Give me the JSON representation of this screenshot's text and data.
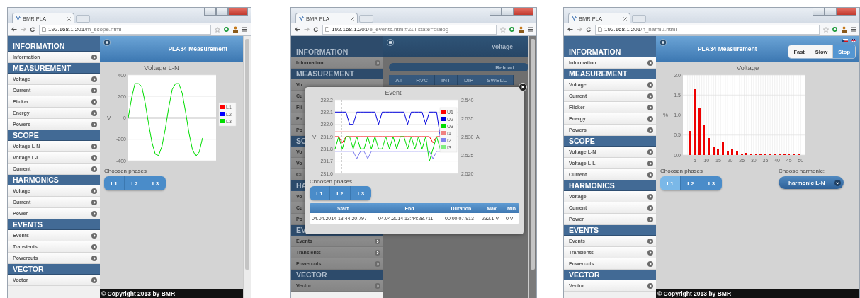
{
  "windows": [
    {
      "browser_tab": {
        "title": "BMR PLA"
      },
      "url": {
        "host": "192.168.1.201",
        "path": "/m_scope.html"
      },
      "dimmed": false,
      "sidebar": {
        "sections": [
          {
            "title": "INFORMATION",
            "items": [
              {
                "label": "Information"
              }
            ]
          },
          {
            "title": "MEASUREMENT",
            "items": [
              {
                "label": "Voltage"
              },
              {
                "label": "Current"
              },
              {
                "label": "Flicker"
              },
              {
                "label": "Energy"
              },
              {
                "label": "Powers"
              }
            ]
          },
          {
            "title": "SCOPE",
            "items": [
              {
                "label": "Voltage L-N"
              },
              {
                "label": "Voltage L-L"
              },
              {
                "label": "Current"
              }
            ]
          },
          {
            "title": "HARMONICS",
            "items": [
              {
                "label": "Voltage"
              },
              {
                "label": "Current"
              },
              {
                "label": "Power"
              }
            ]
          },
          {
            "title": "EVENTS",
            "items": [
              {
                "label": "Events"
              },
              {
                "label": "Transients"
              },
              {
                "label": "Powercuts"
              }
            ]
          },
          {
            "title": "VECTOR",
            "items": [
              {
                "label": "Vector"
              }
            ]
          }
        ]
      },
      "header": {
        "title": "PLA34 Measurement"
      },
      "content": {
        "kind": "scope",
        "chart_data": {
          "type": "line",
          "title": "Voltage L-N",
          "ylabel": "V",
          "grid": true,
          "legend": "right",
          "categories": [
            null,
            null,
            null,
            null,
            null,
            null,
            null,
            null,
            null,
            null,
            null,
            null,
            null,
            null,
            null,
            null,
            null,
            null,
            null,
            null,
            null,
            null,
            null,
            null,
            null,
            null,
            null
          ],
          "ylim": [
            -400,
            400
          ],
          "yticks": [
            -400,
            -200,
            0,
            200,
            400
          ],
          "series": [
            {
              "name": "L1",
              "color": "#ff0000",
              "values": [
                null,
                null,
                null,
                null,
                null,
                null,
                null,
                null,
                null,
                null,
                null,
                null,
                null,
                null,
                null,
                null,
                null,
                null,
                null,
                null,
                null,
                null,
                null,
                null,
                null,
                null,
                null
              ]
            },
            {
              "name": "L2",
              "color": "#0000ff",
              "values": [
                null,
                null,
                null,
                null,
                null,
                null,
                null,
                null,
                null,
                null,
                null,
                null,
                null,
                null,
                null,
                null,
                null,
                null,
                null,
                null,
                null,
                null,
                null,
                null,
                null,
                null,
                null
              ]
            },
            {
              "name": "L3",
              "color": "#00dd00",
              "values": [
                0,
                187,
                320,
                320,
                294,
                144,
                -49,
                -227,
                -339,
                -352,
                -263,
                -97,
                97,
                263,
                320,
                320,
                228,
                50,
                -143,
                -294,
                -359,
                -320,
                -188,
                null,
                null,
                null,
                null
              ]
            }
          ]
        },
        "phases_label": "Choosen phases",
        "phases": [
          {
            "label": "L1",
            "selected": false
          },
          {
            "label": "L2",
            "selected": false
          },
          {
            "label": "L3",
            "selected": false
          }
        ]
      },
      "footer": "© Copyright 2013 by BMR"
    },
    {
      "browser_tab": {
        "title": "BMR PLA"
      },
      "url": {
        "host": "192.168.1.201",
        "path": "/e_events.html#&ui-state=dialog"
      },
      "dimmed": true,
      "sidebar": {
        "sections": [
          {
            "title": "INFORMATION",
            "items": [
              {
                "label": "Information"
              }
            ]
          },
          {
            "title": "MEASUREMENT",
            "items": [
              {
                "label": "Vo"
              },
              {
                "label": "Cu"
              },
              {
                "label": "Fli"
              },
              {
                "label": "En"
              },
              {
                "label": "Po"
              }
            ]
          },
          {
            "title": "SC",
            "items": [
              {
                "label": "Vo"
              },
              {
                "label": "Vo"
              },
              {
                "label": "Cu"
              }
            ]
          },
          {
            "title": "HA",
            "items": [
              {
                "label": "Vo"
              },
              {
                "label": "Cu"
              },
              {
                "label": "Po"
              }
            ]
          },
          {
            "title": "EV",
            "items": [
              {
                "label": "Events"
              },
              {
                "label": "Transients"
              },
              {
                "label": "Powercuts"
              }
            ]
          },
          {
            "title": "VECTOR",
            "items": [
              {
                "label": "Vector"
              }
            ]
          }
        ]
      },
      "header": {
        "title": "Voltage"
      },
      "content": {
        "kind": "events",
        "reload": "Reload",
        "tabs": [
          {
            "label": "All",
            "selected": false
          },
          {
            "label": "RVC",
            "selected": false
          },
          {
            "label": "INT",
            "selected": false
          },
          {
            "label": "DIP",
            "selected": false
          },
          {
            "label": "SWELL",
            "selected": false
          }
        ]
      },
      "dialog": {
        "chart_data": {
          "type": "line",
          "title": "Event",
          "ylabel": "V",
          "grid": true,
          "legend": "inside right",
          "categories": [
            null,
            null,
            null,
            null,
            null,
            null,
            null,
            null,
            null,
            null,
            null,
            null,
            null,
            null,
            null,
            null,
            null,
            null,
            null,
            null,
            null,
            null,
            null,
            null,
            null,
            null,
            null,
            null,
            null,
            null,
            null,
            null,
            null,
            null,
            null
          ],
          "ylim": [
            231.6,
            232.2
          ],
          "yticks": [
            {
              "value": 231.6,
              "label": "231.6"
            },
            {
              "value": 231.7,
              "label": "231.7"
            },
            {
              "value": 231.8,
              "label": "231.8"
            },
            {
              "value": 231.9,
              "label": "231.9"
            },
            {
              "value": 232.0,
              "label": "232.0"
            },
            {
              "value": 232.1,
              "label": "232.1"
            },
            {
              "value": 232.2,
              "label": "232.2"
            }
          ],
          "series": [
            {
              "name": "U1",
              "color": "#ff0000",
              "values": [
                231.9,
                231.9,
                231.85,
                231.9,
                231.9,
                231.9,
                231.9,
                231.9,
                231.9,
                231.9,
                231.9,
                231.9,
                231.9,
                231.9,
                231.9,
                231.9,
                231.9,
                231.9,
                231.9,
                231.9,
                231.9,
                231.9,
                231.9,
                231.9,
                231.9,
                231.9,
                231.9,
                231.85,
                231.9,
                231.9,
                null,
                null,
                null,
                null,
                null
              ]
            },
            {
              "name": "U2",
              "color": "#0000dd",
              "values": [
                232.1,
                232.1,
                232.1,
                232.1,
                232.0,
                232.0,
                232.1,
                232.1,
                232.1,
                232.1,
                232.1,
                232.1,
                232.0,
                232.1,
                232.1,
                232.1,
                232.1,
                232.1,
                232.1,
                232.1,
                232.0,
                232.1,
                232.1,
                232.1,
                232.1,
                232.0,
                232.1,
                232.1,
                232.1,
                231.9,
                null,
                null,
                null,
                null,
                null
              ]
            },
            {
              "name": "U3",
              "color": "#00dd00",
              "values": [
                231.8,
                231.9,
                231.8,
                231.9,
                231.9,
                231.8,
                231.9,
                231.8,
                231.8,
                231.9,
                231.8,
                231.9,
                231.8,
                231.8,
                231.9,
                231.8,
                231.9,
                231.8,
                231.9,
                231.9,
                231.8,
                231.9,
                231.8,
                231.9,
                231.8,
                231.9,
                231.7,
                231.8,
                231.9,
                231.8,
                null,
                null,
                null,
                null,
                null
              ]
            },
            {
              "name": "I1",
              "color": "#f08080",
              "values": [
                231.94,
                231.94,
                231.94,
                231.94,
                231.94,
                231.94,
                231.94,
                231.94,
                231.94,
                231.94,
                231.94,
                231.94,
                231.94,
                231.94,
                231.94,
                231.94,
                231.94,
                231.94,
                231.94,
                231.94,
                231.94,
                231.94,
                231.94,
                231.94,
                231.94,
                231.94,
                231.94,
                231.94,
                231.94,
                231.94,
                null,
                null,
                null,
                null,
                null
              ]
            },
            {
              "name": "I2",
              "color": "#8080ee",
              "values": [
                231.78,
                231.78,
                231.78,
                231.78,
                231.78,
                231.78,
                231.72,
                231.78,
                231.78,
                231.72,
                231.78,
                231.78,
                231.78,
                231.78,
                231.78,
                231.78,
                231.78,
                231.78,
                231.78,
                231.78,
                231.78,
                231.78,
                231.78,
                231.78,
                231.78,
                231.78,
                231.78,
                231.72,
                231.78,
                231.78,
                null,
                null,
                null,
                null,
                null
              ]
            },
            {
              "name": "I3",
              "color": "#80ee80",
              "values": [
                null,
                null,
                null,
                null,
                null,
                null,
                null,
                null,
                null,
                null,
                null,
                null,
                null,
                null,
                null,
                null,
                null,
                null,
                null,
                null,
                null,
                null,
                null,
                null,
                null,
                null,
                null,
                null,
                null,
                null,
                null,
                null,
                null,
                null,
                null
              ]
            }
          ]
        },
        "right_axis": {
          "label": "A",
          "ticks": [
            "2.540",
            "2.535",
            "2.530",
            "2.525",
            "2.520"
          ]
        },
        "phases_label": "Choosen phases",
        "phases": [
          {
            "label": "L1",
            "selected": false
          },
          {
            "label": "L2",
            "selected": false
          },
          {
            "label": "L3",
            "selected": false
          }
        ],
        "table": {
          "columns": [
            "Start",
            "End",
            "Duration",
            "Max",
            "Min"
          ],
          "rows": [
            [
              "04.04.2014 13:44:20.797",
              "04.04.2014 13:44:28.711",
              "00:00:07.913",
              "232.1 V",
              "0 V"
            ]
          ]
        }
      }
    },
    {
      "browser_tab": {
        "title": "BMR PLA"
      },
      "url": {
        "host": "192.168.1.201",
        "path": "/h_harmu.html"
      },
      "dimmed": false,
      "sidebar": {
        "sections": [
          {
            "title": "INFORMATION",
            "items": [
              {
                "label": "Information"
              }
            ]
          },
          {
            "title": "MEASUREMENT",
            "items": [
              {
                "label": "Voltage"
              },
              {
                "label": "Current"
              },
              {
                "label": "Flicker"
              },
              {
                "label": "Energy"
              },
              {
                "label": "Powers"
              }
            ]
          },
          {
            "title": "SCOPE",
            "items": [
              {
                "label": "Voltage L-N"
              },
              {
                "label": "Voltage L-L"
              },
              {
                "label": "Current"
              }
            ]
          },
          {
            "title": "HARMONICS",
            "items": [
              {
                "label": "Voltage"
              },
              {
                "label": "Current"
              },
              {
                "label": "Power"
              }
            ]
          },
          {
            "title": "EVENTS",
            "items": [
              {
                "label": "Events"
              },
              {
                "label": "Transients"
              },
              {
                "label": "Powercuts"
              }
            ]
          },
          {
            "title": "VECTOR",
            "items": [
              {
                "label": "Vector"
              }
            ]
          }
        ]
      },
      "header": {
        "title": "PLA34 Measurement",
        "speed_buttons": [
          {
            "label": "Fast",
            "selected": false
          },
          {
            "label": "Slow",
            "selected": false
          },
          {
            "label": "Stop",
            "selected": true
          }
        ]
      },
      "content": {
        "kind": "harmonics",
        "chart_data": {
          "type": "bar",
          "title": "Voltage",
          "ylabel": "%",
          "grid": true,
          "x": [
            2,
            3,
            4,
            5,
            6,
            7,
            8,
            9,
            10,
            11,
            12,
            13,
            14,
            15,
            16,
            17,
            18,
            19,
            20,
            21,
            22,
            23,
            24,
            25,
            26,
            27,
            28,
            29,
            30,
            31,
            32,
            33,
            34,
            35,
            36,
            37,
            38,
            39,
            40,
            41,
            42,
            43,
            44,
            45,
            46,
            47,
            48,
            49,
            50
          ],
          "xlim": [
            0,
            52
          ],
          "ylim": [
            0,
            2.0
          ],
          "xticks": [
            5,
            10,
            15,
            20,
            25,
            30,
            35,
            40,
            45,
            50
          ],
          "yticks": [
            {
              "value": 0,
              "label": "0.0"
            },
            {
              "value": 0.5,
              "label": "0.5"
            },
            {
              "value": 1.0,
              "label": "1.0"
            },
            {
              "value": 1.5,
              "label": "1.5"
            },
            {
              "value": 2.0,
              "label": "2.0"
            }
          ],
          "values": [
            0,
            0.6,
            0,
            1.65,
            0,
            1.18,
            0,
            0.76,
            0,
            0.43,
            0,
            0.19,
            0,
            0.14,
            0,
            0.34,
            0,
            0.09,
            0,
            0.16,
            0,
            0.09,
            0,
            0.03,
            0,
            0.06,
            0,
            0.04,
            0,
            0.04,
            0,
            0.03,
            0,
            0.02,
            0,
            0.02,
            0,
            0.02,
            0,
            0.01,
            0,
            0.02,
            0,
            0.01,
            0,
            0.01,
            0,
            0.01,
            0
          ]
        },
        "phases_label": "Choosen phases",
        "phases": [
          {
            "label": "L1",
            "selected": true
          },
          {
            "label": "L2",
            "selected": false
          },
          {
            "label": "L3",
            "selected": false
          }
        ],
        "harmonic_label": "Choose harmonic:",
        "harmonic_value": "harmonic L-N"
      },
      "footer": "© Copyright 2013 by BMR"
    }
  ]
}
